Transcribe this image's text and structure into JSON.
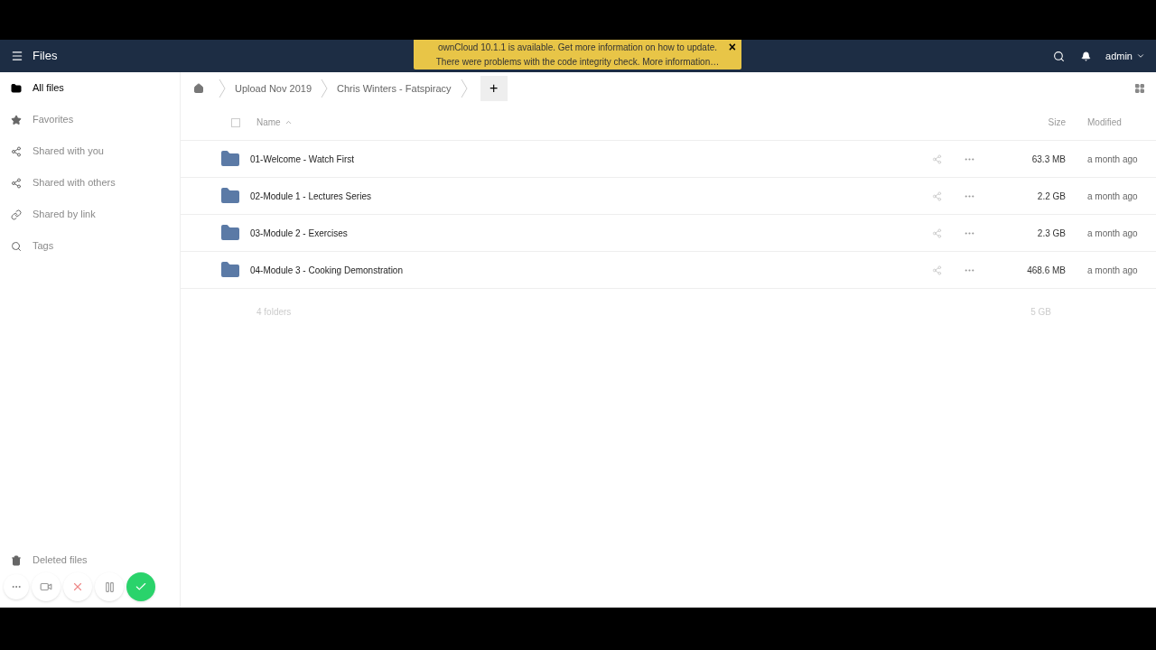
{
  "header": {
    "app_title": "Files",
    "user": "admin"
  },
  "notification": {
    "lines": [
      "ownCloud 10.1.1 is available. Get more information on how to update.",
      "There were problems with the code integrity check. More information…"
    ],
    "close": "×"
  },
  "sidebar": {
    "items": [
      {
        "label": "All files",
        "kind": "folder",
        "selected": true
      },
      {
        "label": "Favorites",
        "kind": "star",
        "selected": false
      },
      {
        "label": "Shared with you",
        "kind": "share",
        "selected": false
      },
      {
        "label": "Shared with others",
        "kind": "share",
        "selected": false
      },
      {
        "label": "Shared by link",
        "kind": "link",
        "selected": false
      },
      {
        "label": "Tags",
        "kind": "search",
        "selected": false
      }
    ],
    "bottom_items": [
      {
        "label": "Deleted files",
        "kind": "trash",
        "selected": false
      }
    ]
  },
  "breadcrumbs": [
    "Upload Nov 2019",
    "Chris Winters - Fatspiracy"
  ],
  "new_button": "+",
  "table": {
    "select_all": {
      "checked": false
    },
    "columns": [
      "Name",
      "Size",
      "Modified"
    ],
    "rows": [
      {
        "name": "01-Welcome - Watch First",
        "size": "63.3 MB",
        "modified": "a month ago"
      },
      {
        "name": "02-Module 1 - Lectures Series",
        "size": "2.2 GB",
        "modified": "a month ago"
      },
      {
        "name": "03-Module 2 - Exercises",
        "size": "2.3 GB",
        "modified": "a month ago"
      },
      {
        "name": "04-Module 3 - Cooking Demonstration",
        "size": "468.6 MB",
        "modified": "a month ago"
      }
    ],
    "summary": {
      "count": "4 folders",
      "size": "5 GB"
    }
  }
}
